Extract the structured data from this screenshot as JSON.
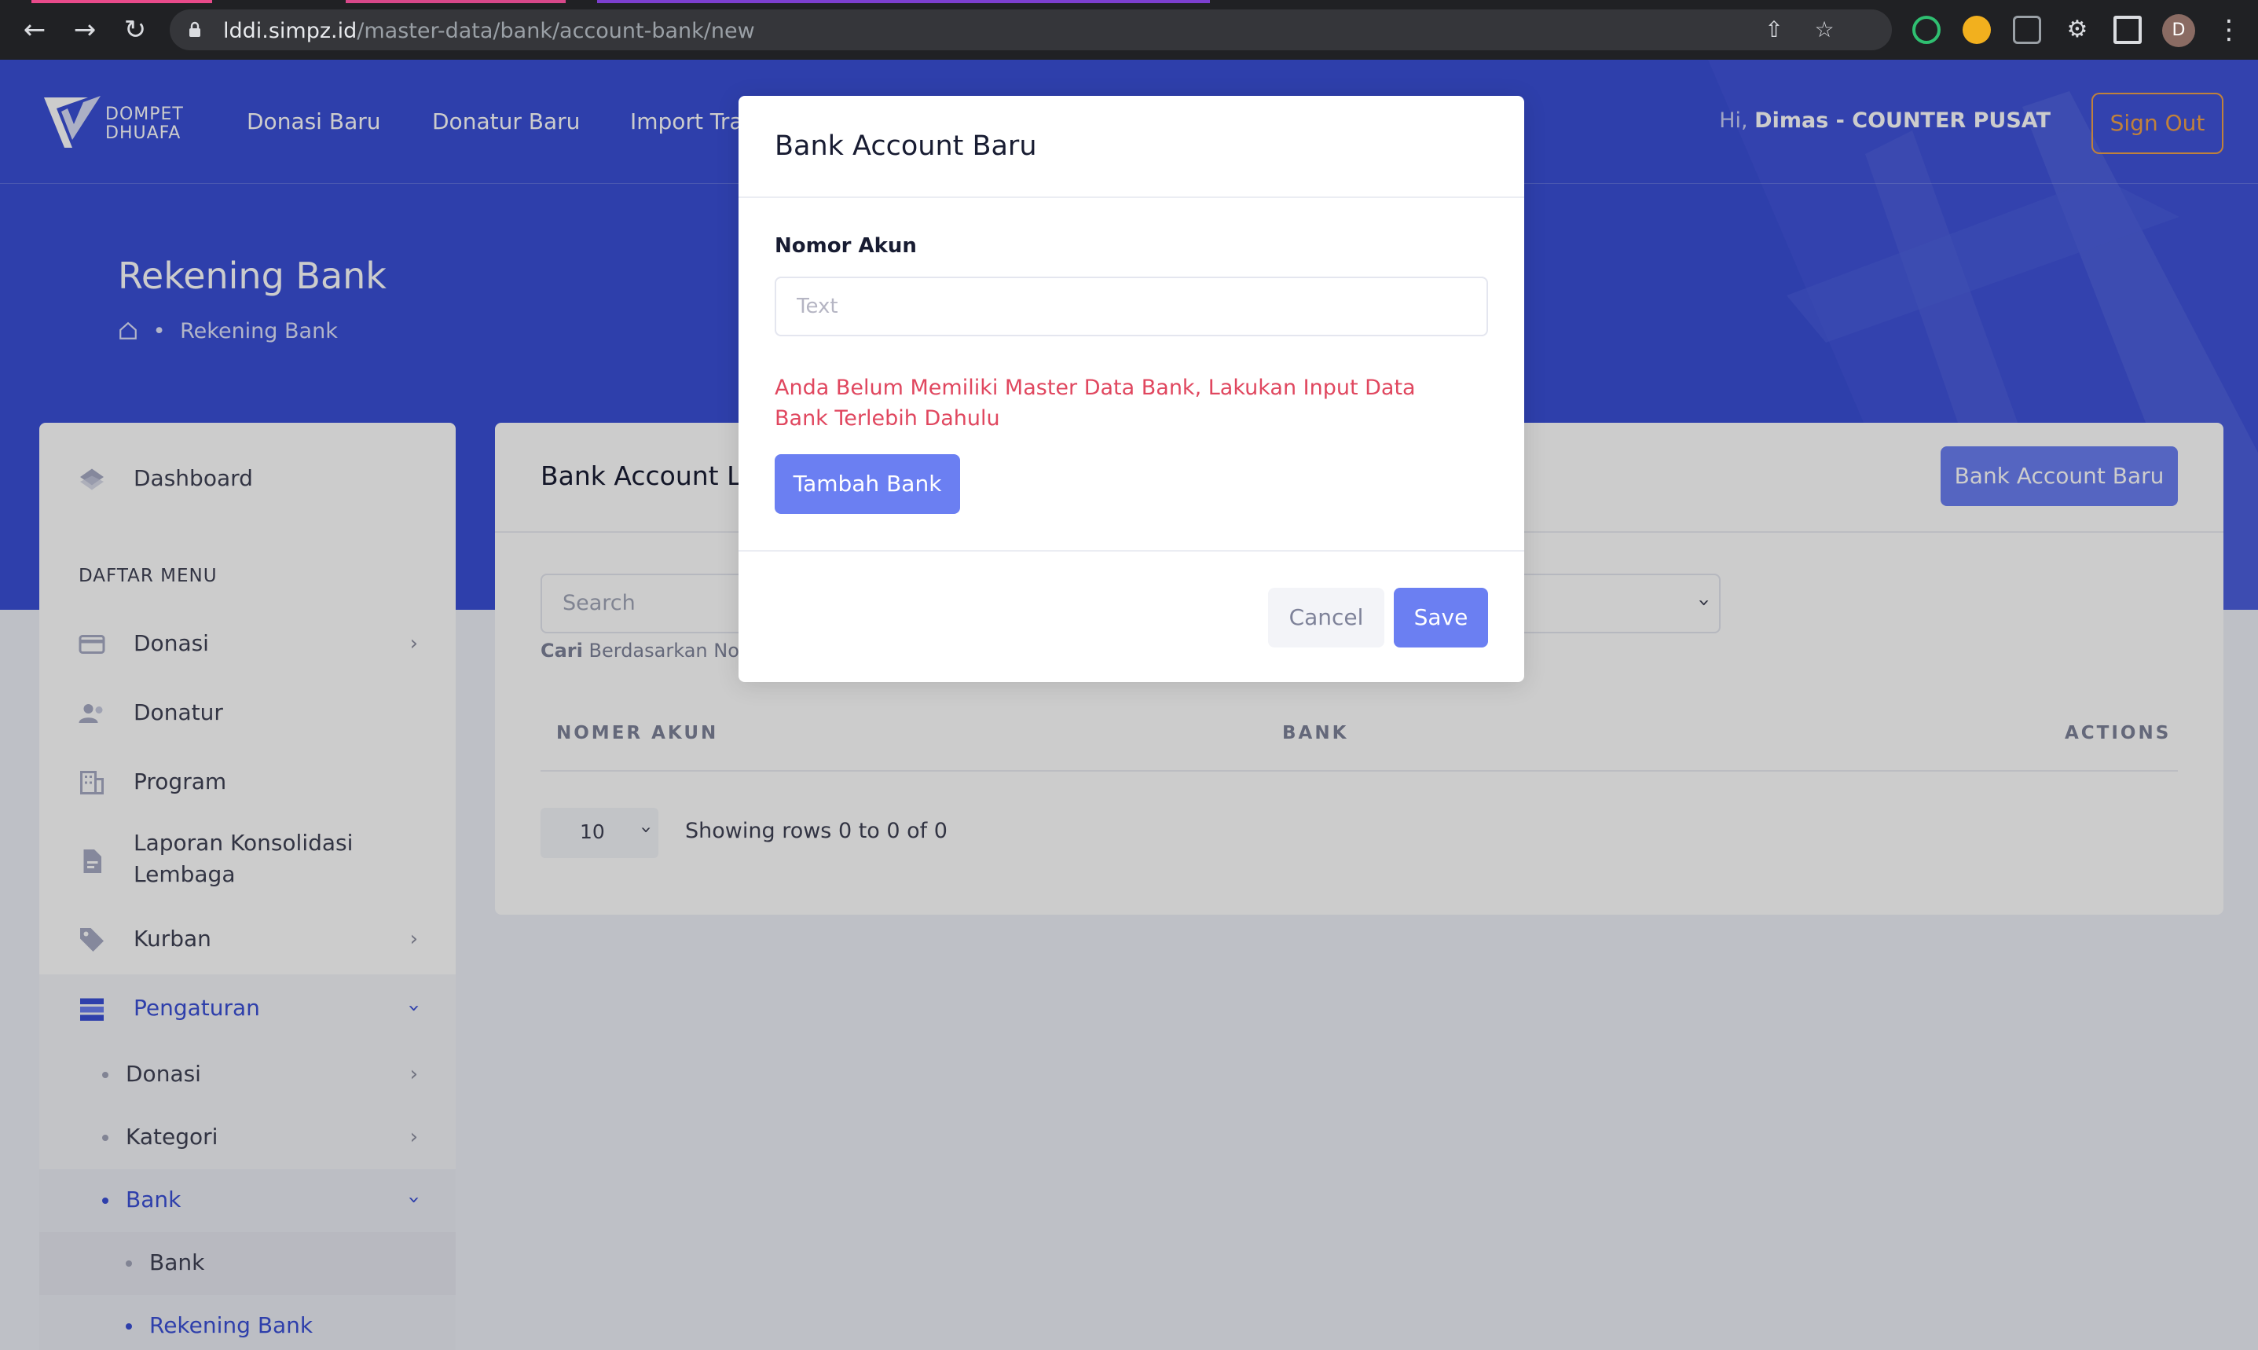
{
  "browser": {
    "url_host": "lddi.simpz.id",
    "url_path": "/master-data/bank/account-bank/new",
    "profile_initial": "D"
  },
  "header": {
    "logo_line1": "DOMPET",
    "logo_line2": "DHUAFA",
    "nav": [
      "Donasi Baru",
      "Donatur Baru",
      "Import Tra"
    ],
    "greeting_prefix": "Hi,",
    "user_name": "Dimas - COUNTER PUSAT",
    "signout_label": "Sign Out"
  },
  "page": {
    "title": "Rekening Bank",
    "breadcrumb": "Rekening Bank"
  },
  "sidebar": {
    "dashboard": "Dashboard",
    "section": "DAFTAR MENU",
    "items": [
      {
        "label": "Donasi",
        "icon": "credit-card-icon"
      },
      {
        "label": "Donatur",
        "icon": "users-icon"
      },
      {
        "label": "Program",
        "icon": "building-icon"
      },
      {
        "label": "Laporan Konsolidasi",
        "label2": "Lembaga",
        "icon": "document-icon"
      },
      {
        "label": "Kurban",
        "icon": "tag-icon"
      },
      {
        "label": "Pengaturan",
        "icon": "server-icon"
      }
    ],
    "sub": [
      "Donasi",
      "Kategori",
      "Bank"
    ],
    "subsub": [
      "Bank",
      "Rekening Bank"
    ]
  },
  "card": {
    "title": "Bank Account L",
    "new_button": "Bank Account Baru",
    "search_placeholder": "Search",
    "search_hint_bold": "Cari",
    "search_hint": "Berdasarkan Nor",
    "columns": [
      "NOMER AKUN",
      "BANK",
      "ACTIONS"
    ],
    "page_size": "10",
    "rows_info": "Showing rows 0 to 0 of 0"
  },
  "modal": {
    "title": "Bank Account Baru",
    "field_label": "Nomor Akun",
    "field_placeholder": "Text",
    "field_value": "",
    "error": "Anda Belum Memiliki Master Data Bank, Lakukan Input Data Bank Terlebih Dahulu",
    "add_bank_button": "Tambah Bank",
    "cancel_button": "Cancel",
    "save_button": "Save"
  },
  "colors": {
    "brand_blue": "#3a4fd6",
    "primary_button": "#6b7ff2",
    "error": "#e0475f",
    "signout": "#f0a24a"
  }
}
